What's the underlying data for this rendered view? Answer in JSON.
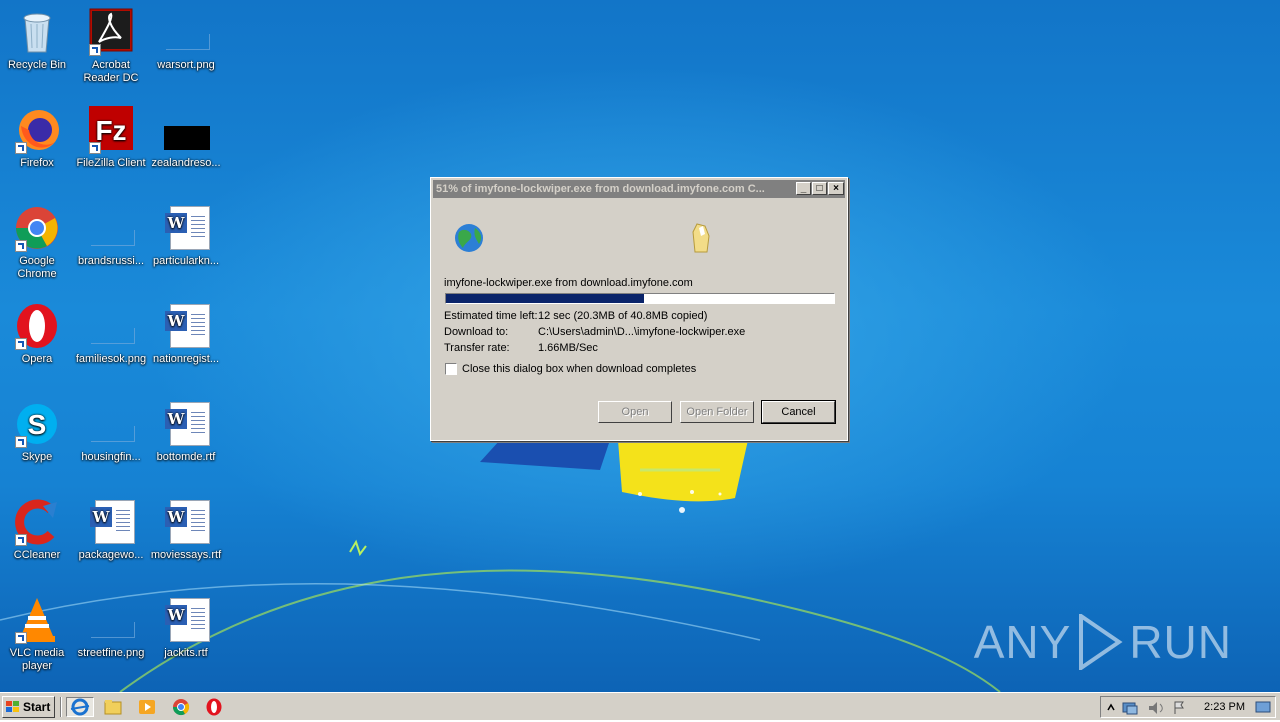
{
  "desktop_icons": [
    {
      "label": "Recycle Bin",
      "icon": "recycle-bin-icon"
    },
    {
      "label": "Acrobat Reader DC",
      "icon": "acrobat-icon"
    },
    {
      "label": "warsort.png",
      "icon": "image-file-icon"
    },
    {
      "label": "Firefox",
      "icon": "firefox-icon"
    },
    {
      "label": "FileZilla Client",
      "icon": "filezilla-icon"
    },
    {
      "label": "zealandreso...",
      "icon": "image-file-icon"
    },
    {
      "label": "Google Chrome",
      "icon": "chrome-icon"
    },
    {
      "label": "brandsrussi...",
      "icon": "image-file-icon"
    },
    {
      "label": "particularkn...",
      "icon": "word-doc-icon"
    },
    {
      "label": "Opera",
      "icon": "opera-icon"
    },
    {
      "label": "familiesok.png",
      "icon": "image-file-icon"
    },
    {
      "label": "nationregist...",
      "icon": "word-doc-icon"
    },
    {
      "label": "Skype",
      "icon": "skype-icon"
    },
    {
      "label": "housingfin...",
      "icon": "image-file-icon"
    },
    {
      "label": "bottomde.rtf",
      "icon": "word-doc-icon"
    },
    {
      "label": "CCleaner",
      "icon": "ccleaner-icon"
    },
    {
      "label": "packagewo...",
      "icon": "word-doc-icon"
    },
    {
      "label": "moviessays.rtf",
      "icon": "word-doc-icon"
    },
    {
      "label": "VLC media player",
      "icon": "vlc-icon"
    },
    {
      "label": "streetfine.png",
      "icon": "image-file-icon"
    },
    {
      "label": "jackits.rtf",
      "icon": "word-doc-icon"
    }
  ],
  "dialog": {
    "title": "51% of imyfone-lockwiper.exe from download.imyfone.com C...",
    "file_line": "imyfone-lockwiper.exe from download.imyfone.com",
    "progress_fraction": 0.51,
    "est_label": "Estimated time left:",
    "est_value": "12 sec (20.3MB of 40.8MB copied)",
    "download_label": "Download to:",
    "download_value": "C:\\Users\\admin\\D...\\imyfone-lockwiper.exe",
    "rate_label": "Transfer rate:",
    "rate_value": "1.66MB/Sec",
    "close_checkbox_label": "Close this dialog box when download completes",
    "close_checkbox_checked": false,
    "open_label": "Open",
    "open_folder_label": "Open Folder",
    "cancel_label": "Cancel"
  },
  "taskbar": {
    "start_label": "Start",
    "clock": "2:23 PM",
    "quicklaunch": [
      "ie-icon",
      "explorer-icon",
      "media-player-icon",
      "chrome-icon",
      "opera-icon"
    ]
  },
  "watermark": {
    "left": "ANY",
    "right": "RUN"
  }
}
